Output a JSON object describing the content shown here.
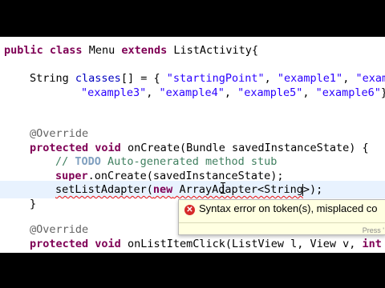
{
  "code": {
    "l1": {
      "kw1": "public",
      "kw2": "class",
      "t1": " Menu ",
      "kw3": "extends",
      "t2": " ListActivity{"
    },
    "l2": {
      "t1": "String ",
      "field": "classes",
      "t2": "[] = { ",
      "s1": "\"startingPoint\"",
      "t3": ", ",
      "s2": "\"example1\"",
      "t4": ", ",
      "s3": "\"exam"
    },
    "l3": {
      "s1": "\"example3\"",
      "t1": ", ",
      "s2": "\"example4\"",
      "t2": ", ",
      "s3": "\"example5\"",
      "t3": ", ",
      "s4": "\"example6\"",
      "t4": "}"
    },
    "l4": {
      "ann": "@Override"
    },
    "l5": {
      "kw1": "protected",
      "kw2": "void",
      "t1": " onCreate(Bundle savedInstanceState) {"
    },
    "l6": {
      "c1": "// ",
      "todo": "TODO",
      "c2": " Auto-generated method stub"
    },
    "l7": {
      "kw": "super",
      "t1": ".onCreate(savedInstanceState);"
    },
    "l8": {
      "e1": "setListAdapter(",
      "kw": "new",
      "e2": " ArrayAdapter<String",
      "t1": ">);"
    },
    "l9": {
      "t1": "}"
    },
    "l10": {
      "ann": "@Override"
    },
    "l11": {
      "kw1": "protected",
      "kw2": "void",
      "t1": " onListItemClick(ListView l, View v, ",
      "kw3": "int"
    }
  },
  "tooltip": {
    "message": "Syntax error on token(s), misplaced co",
    "hint": "Press '",
    "icon": "error-icon"
  },
  "colors": {
    "keyword": "#7f0055",
    "string": "#2a00ff",
    "field": "#0000c0",
    "comment": "#3f7f5f",
    "error": "#e11111",
    "tooltip_bg": "#ffffe1"
  }
}
